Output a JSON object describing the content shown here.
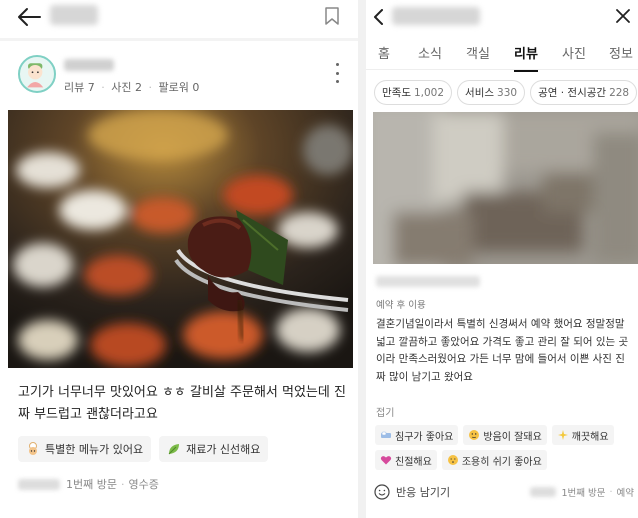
{
  "left": {
    "profile": {
      "reviews": "리뷰 7",
      "photos": "사진 2",
      "followers": "팔로워 0"
    },
    "review": {
      "text": "고기가 너무너무 맛있어요 ㅎㅎ 갈비살 주문해서 먹었는데 진짜 부드럽고 괜찮더라고요"
    },
    "tags": [
      {
        "icon": "chef-icon",
        "label": "특별한 메뉴가 있어요"
      },
      {
        "icon": "leaf-icon",
        "label": "재료가 신선해요"
      }
    ],
    "visit": {
      "count": "1번째 방문",
      "receipt": "영수증"
    }
  },
  "right": {
    "tabs": [
      "홈",
      "소식",
      "객실",
      "리뷰",
      "사진",
      "정보"
    ],
    "active_tab": "리뷰",
    "chips": [
      {
        "label": "만족도",
        "count": "1,002"
      },
      {
        "label": "서비스",
        "count": "330"
      },
      {
        "label": "공연 · 전시공간",
        "count": "228"
      }
    ],
    "reserved_label": "예약 후 이용",
    "review_text": "결혼기념일이라서 특별히 신경써서 예약 했어요 정말정말 넓고 깔끔하고 좋았어요 가격도 좋고 관리 잘 되어 있는 곳이라 만족스러웠어요 가든 너무 맘에 들어서 이쁜 사진 진짜 많이 남기고 왔어요",
    "fold_label": "접기",
    "tags": [
      {
        "icon": "bed-icon",
        "label": "침구가 좋아요"
      },
      {
        "icon": "soundproof-icon",
        "label": "방음이 잘돼요"
      },
      {
        "icon": "sparkle-icon",
        "label": "깨끗해요"
      },
      {
        "icon": "heart-icon",
        "label": "친절해요"
      },
      {
        "icon": "quiet-icon",
        "label": "조용히 쉬기 좋아요"
      }
    ],
    "reaction_label": "반응 남기기",
    "visit_count": "1번째 방문",
    "visit_type": "예약"
  },
  "colors": {
    "avatar_ring": "#7fd0c4",
    "tag_bg": "#f4f4f4",
    "active_tab": "#111111"
  }
}
